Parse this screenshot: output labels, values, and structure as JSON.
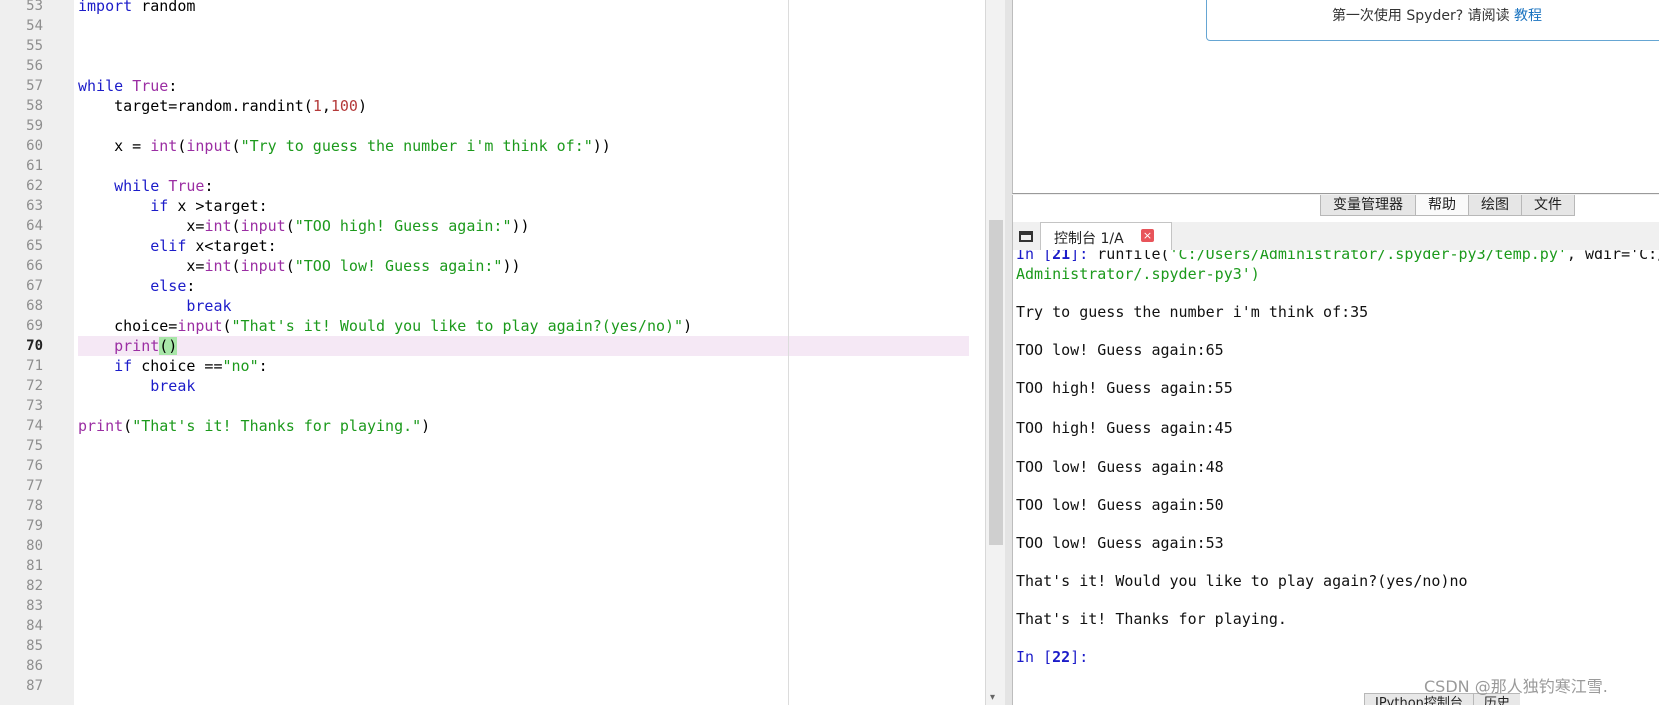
{
  "editor": {
    "current_line": 70,
    "line_numbers": [
      "53",
      "54",
      "55",
      "56",
      "57",
      "58",
      "59",
      "60",
      "61",
      "62",
      "63",
      "64",
      "65",
      "66",
      "67",
      "68",
      "69",
      "70",
      "71",
      "72",
      "73",
      "74",
      "75",
      "76",
      "77",
      "78",
      "79",
      "80",
      "81",
      "82",
      "83",
      "84",
      "85",
      "86",
      "87"
    ],
    "code": {
      "l53_kw": "import",
      "l53_rest": " random",
      "l57_kw": "while",
      "l57_true": "True",
      "l57_colon": ":",
      "l58_a": "    target=random.randint(",
      "l58_n1": "1",
      "l58_comma": ",",
      "l58_n2": "100",
      "l58_close": ")",
      "l60_a": "    x = ",
      "l60_int": "int",
      "l60_p": "(",
      "l60_input": "input",
      "l60_p2": "(",
      "l60_str": "\"Try to guess the number i'm think of:\"",
      "l60_close": "))",
      "l62_indent": "    ",
      "l62_kw": "while",
      "l62_sp": " ",
      "l62_true": "True",
      "l62_colon": ":",
      "l63_indent": "        ",
      "l63_kw": "if",
      "l63_rest": " x >target:",
      "l64_a": "            x=",
      "l64_int": "int",
      "l64_p": "(",
      "l64_input": "input",
      "l64_p2": "(",
      "l64_str": "\"TOO high! Guess again:\"",
      "l64_close": "))",
      "l65_indent": "        ",
      "l65_kw": "elif",
      "l65_rest": " x<target:",
      "l66_a": "            x=",
      "l66_int": "int",
      "l66_p": "(",
      "l66_input": "input",
      "l66_p2": "(",
      "l66_str": "\"TOO low! Guess again:\"",
      "l66_close": "))",
      "l67_indent": "        ",
      "l67_kw": "else",
      "l67_colon": ":",
      "l68_indent": "            ",
      "l68_kw": "break",
      "l69_a": "    choice=",
      "l69_input": "input",
      "l69_p": "(",
      "l69_str": "\"That's it! Would you like to play again?(yes/no)\"",
      "l69_close": ")",
      "l70_indent": "    ",
      "l70_print": "print",
      "l70_parens": "()",
      "l71_indent": "    ",
      "l71_kw": "if",
      "l71_rest": " choice ==",
      "l71_str": "\"no\"",
      "l71_colon": ":",
      "l72_indent": "        ",
      "l72_kw": "break",
      "l74_print": "print",
      "l74_p": "(",
      "l74_str": "\"That's it! Thanks for playing.\"",
      "l74_close": ")"
    }
  },
  "help": {
    "banner_text": "第一次使用 Spyder? 请阅读 ",
    "banner_link": "教程"
  },
  "pane_tabs": {
    "variable_explorer": "变量管理器",
    "help": "帮助",
    "plots": "绘图",
    "files": "文件"
  },
  "console": {
    "tab_label": "控制台 1/A",
    "tab_close": "×",
    "runfile_prompt": "In [",
    "runfile_num": "21",
    "runfile_prompt_end": "]:",
    "runfile_call": " runfile(",
    "runfile_path": "'C:/Users/Administrator/.spyder-py3/temp.py'",
    "runfile_wdir": ", wdir='C:/",
    "runfile_line2": "Administrator/.spyder-py3')",
    "output": [
      "Try to guess the number i'm think of:35",
      "TOO low! Guess again:65",
      "TOO high! Guess again:55",
      "TOO high! Guess again:45",
      "TOO low! Guess again:48",
      "TOO low! Guess again:50",
      "TOO low! Guess again:53",
      "That's it! Would you like to play again?(yes/no)no",
      "That's it! Thanks for playing."
    ],
    "next_prompt": "In [",
    "next_num": "22",
    "next_prompt_end": "]:"
  },
  "bottom_tabs": {
    "ipython": "IPython控制台",
    "history": "历史"
  },
  "watermark": "CSDN @那人独钓寒江雪."
}
